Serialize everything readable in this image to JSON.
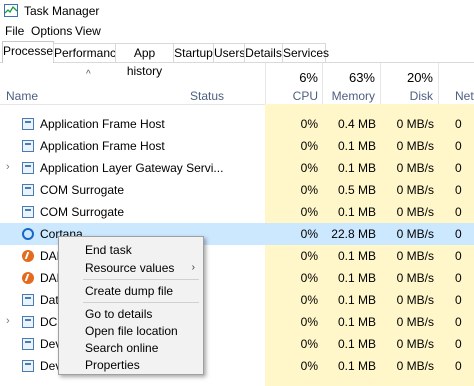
{
  "window": {
    "title": "Task Manager"
  },
  "menu": [
    "File",
    "Options",
    "View"
  ],
  "tabs": [
    "Processes",
    "Performance",
    "App history",
    "Startup",
    "Users",
    "Details",
    "Services"
  ],
  "header": {
    "name": "Name",
    "status": "Status",
    "cpu": {
      "pct": "6%",
      "label": "CPU"
    },
    "memory": {
      "pct": "63%",
      "label": "Memory"
    },
    "disk": {
      "pct": "20%",
      "label": "Disk"
    },
    "network": {
      "pct": "",
      "label": "Netw"
    }
  },
  "rows": [
    {
      "name": "Application Frame Host",
      "cpu": "0%",
      "memory": "0.4 MB",
      "disk": "0 MB/s",
      "net": "0",
      "icon": "window-icon",
      "expand": ""
    },
    {
      "name": "Application Frame Host",
      "cpu": "0%",
      "memory": "0.1 MB",
      "disk": "0 MB/s",
      "net": "0",
      "icon": "window-icon",
      "expand": ""
    },
    {
      "name": "Application Layer Gateway Servi...",
      "cpu": "0%",
      "memory": "0.1 MB",
      "disk": "0 MB/s",
      "net": "0",
      "icon": "window-icon",
      "expand": "›"
    },
    {
      "name": "COM Surrogate",
      "cpu": "0%",
      "memory": "0.5 MB",
      "disk": "0 MB/s",
      "net": "0",
      "icon": "window-icon",
      "expand": ""
    },
    {
      "name": "COM Surrogate",
      "cpu": "0%",
      "memory": "0.1 MB",
      "disk": "0 MB/s",
      "net": "0",
      "icon": "window-icon",
      "expand": ""
    },
    {
      "name": "Cortana",
      "cpu": "0%",
      "memory": "22.8 MB",
      "disk": "0 MB/s",
      "net": "0",
      "icon": "cortana-icon",
      "expand": ""
    },
    {
      "name": "DAE",
      "cpu": "0%",
      "memory": "0.1 MB",
      "disk": "0 MB/s",
      "net": "0",
      "icon": "orange-app-icon",
      "expand": ""
    },
    {
      "name": "DAE",
      "cpu": "0%",
      "memory": "0.1 MB",
      "disk": "0 MB/s",
      "net": "0",
      "icon": "orange-app-icon",
      "expand": ""
    },
    {
      "name": "Data",
      "cpu": "0%",
      "memory": "0.1 MB",
      "disk": "0 MB/s",
      "net": "0",
      "icon": "window-icon",
      "expand": ""
    },
    {
      "name": "DCS",
      "cpu": "0%",
      "memory": "0.1 MB",
      "disk": "0 MB/s",
      "net": "0",
      "icon": "window-icon",
      "expand": "›"
    },
    {
      "name": "Dev",
      "cpu": "0%",
      "memory": "0.1 MB",
      "disk": "0 MB/s",
      "net": "0",
      "icon": "window-icon",
      "expand": ""
    },
    {
      "name": "Dev",
      "cpu": "0%",
      "memory": "0.1 MB",
      "disk": "0 MB/s",
      "net": "0",
      "icon": "window-icon",
      "expand": ""
    }
  ],
  "context_menu": {
    "end_task": "End task",
    "resource_values": "Resource values",
    "create_dump": "Create dump file",
    "go_to_details": "Go to details",
    "open_file_location": "Open file location",
    "search_online": "Search online",
    "properties": "Properties"
  },
  "colors": {
    "highlight": "#fff7c9",
    "selected": "#cce8ff",
    "header_text": "#4d6082"
  }
}
